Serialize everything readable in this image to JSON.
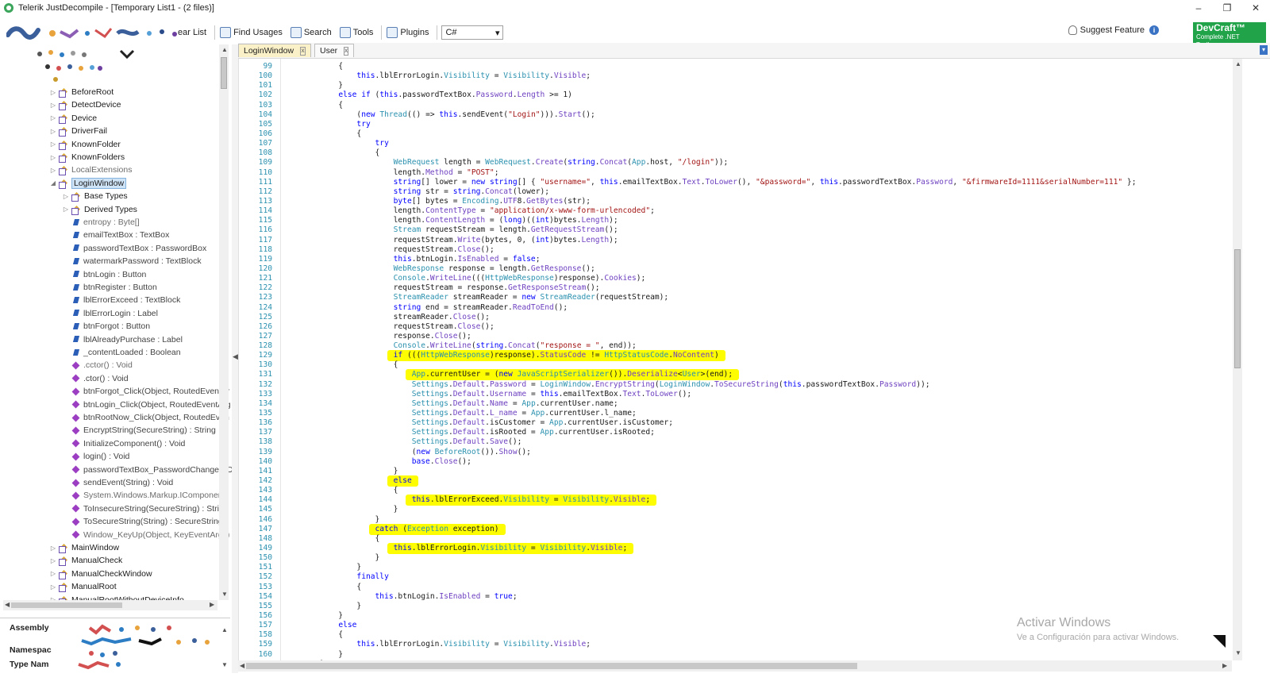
{
  "window": {
    "title": "Telerik JustDecompile - [Temporary List1 - (2 files)]",
    "minimize": "–",
    "restore": "❐",
    "close": "✕"
  },
  "toolbar": {
    "assembly_list_label": "ear List",
    "find_usages_label": "Find Usages",
    "search_label": "Search",
    "tools_label": "Tools",
    "plugins_label": "Plugins",
    "language_value": "C#",
    "suggest_feature_label": "Suggest Feature",
    "info_glyph": "i",
    "devcraft_title": "DevCraft™",
    "devcraft_subtitle": "Complete .NET Toolbox"
  },
  "tree": {
    "items": [
      {
        "label": "BeforeRoot",
        "kind": "class",
        "indent": 1
      },
      {
        "label": "DetectDevice",
        "kind": "class",
        "indent": 1
      },
      {
        "label": "Device",
        "kind": "class",
        "indent": 1
      },
      {
        "label": "DriverFail",
        "kind": "class",
        "indent": 1
      },
      {
        "label": "KnownFolder",
        "kind": "class",
        "indent": 1
      },
      {
        "label": "KnownFolders",
        "kind": "class",
        "indent": 1
      },
      {
        "label": "LocalExtensions",
        "kind": "class",
        "indent": 1,
        "dim": true
      },
      {
        "label": "LoginWindow",
        "kind": "class",
        "indent": 1,
        "selected": true,
        "expanded": true
      },
      {
        "label": "Base Types",
        "kind": "folder",
        "indent": 2
      },
      {
        "label": "Derived Types",
        "kind": "folder",
        "indent": 2
      },
      {
        "label": "entropy : Byte[]",
        "kind": "field",
        "indent": 2,
        "dim": true
      },
      {
        "label": "emailTextBox : TextBox",
        "kind": "field",
        "indent": 2
      },
      {
        "label": "passwordTextBox : PasswordBox",
        "kind": "field",
        "indent": 2
      },
      {
        "label": "watermarkPassword : TextBlock",
        "kind": "field",
        "indent": 2
      },
      {
        "label": "btnLogin : Button",
        "kind": "field",
        "indent": 2
      },
      {
        "label": "btnRegister : Button",
        "kind": "field",
        "indent": 2
      },
      {
        "label": "lblErrorExceed : TextBlock",
        "kind": "field",
        "indent": 2
      },
      {
        "label": "lblErrorLogin : Label",
        "kind": "field",
        "indent": 2
      },
      {
        "label": "btnForgot : Button",
        "kind": "field",
        "indent": 2
      },
      {
        "label": "lblAlreadyPurchase : Label",
        "kind": "field",
        "indent": 2
      },
      {
        "label": "_contentLoaded : Boolean",
        "kind": "field",
        "indent": 2
      },
      {
        "label": ".cctor() : Void",
        "kind": "method",
        "indent": 2,
        "dim": true
      },
      {
        "label": ".ctor() : Void",
        "kind": "method",
        "indent": 2
      },
      {
        "label": "btnForgot_Click(Object, RoutedEventAr",
        "kind": "method",
        "indent": 2
      },
      {
        "label": "btnLogin_Click(Object, RoutedEventArg",
        "kind": "method",
        "indent": 2
      },
      {
        "label": "btnRootNow_Click(Object, RoutedEven",
        "kind": "method",
        "indent": 2
      },
      {
        "label": "EncryptString(SecureString) : String",
        "kind": "method",
        "indent": 2
      },
      {
        "label": "InitializeComponent() : Void",
        "kind": "method",
        "indent": 2
      },
      {
        "label": "login() : Void",
        "kind": "method",
        "indent": 2
      },
      {
        "label": "passwordTextBox_PasswordChanged(O",
        "kind": "method",
        "indent": 2
      },
      {
        "label": "sendEvent(String) : Void",
        "kind": "method",
        "indent": 2
      },
      {
        "label": "System.Windows.Markup.IComponent",
        "kind": "method",
        "indent": 2,
        "dim": true
      },
      {
        "label": "ToInsecureString(SecureString) : String",
        "kind": "method",
        "indent": 2
      },
      {
        "label": "ToSecureString(String) : SecureString",
        "kind": "method",
        "indent": 2
      },
      {
        "label": "Window_KeyUp(Object, KeyEventArgs)",
        "kind": "method",
        "indent": 2,
        "dim": true
      },
      {
        "label": "MainWindow",
        "kind": "class",
        "indent": 1
      },
      {
        "label": "ManualCheck",
        "kind": "class",
        "indent": 1
      },
      {
        "label": "ManualCheckWindow",
        "kind": "class",
        "indent": 1
      },
      {
        "label": "ManualRoot",
        "kind": "class",
        "indent": 1
      },
      {
        "label": "ManualRootWithoutDeviceInfo",
        "kind": "class",
        "indent": 1
      }
    ]
  },
  "info_panel": {
    "assembly_label": "Assembly",
    "namespace_label": "Namespac",
    "type_name_label": "Type Nam"
  },
  "tabs": [
    {
      "label": "LoginWindow",
      "close": "x",
      "active": true
    },
    {
      "label": "User",
      "close": "x",
      "active": false
    }
  ],
  "code": {
    "first_line": 99,
    "lines": [
      "            {",
      "                this.lblErrorLogin.Visibility = Visibility.Visible;",
      "            }",
      "            else if (this.passwordTextBox.Password.Length >= 1)",
      "            {",
      "                (new Thread(() => this.sendEvent(\"Login\"))).Start();",
      "                try",
      "                {",
      "                    try",
      "                    {",
      "                        WebRequest length = WebRequest.Create(string.Concat(App.host, \"/login\"));",
      "                        length.Method = \"POST\";",
      "                        string[] lower = new string[] { \"username=\", this.emailTextBox.Text.ToLower(), \"&password=\", this.passwordTextBox.Password, \"&firmwareId=1111&serialNumber=111\" };",
      "                        string str = string.Concat(lower);",
      "                        byte[] bytes = Encoding.UTF8.GetBytes(str);",
      "                        length.ContentType = \"application/x-www-form-urlencoded\";",
      "                        length.ContentLength = (long)((int)bytes.Length);",
      "                        Stream requestStream = length.GetRequestStream();",
      "                        requestStream.Write(bytes, 0, (int)bytes.Length);",
      "                        requestStream.Close();",
      "                        this.btnLogin.IsEnabled = false;",
      "                        WebResponse response = length.GetResponse();",
      "                        Console.WriteLine(((HttpWebResponse)response).Cookies);",
      "                        requestStream = response.GetResponseStream();",
      "                        StreamReader streamReader = new StreamReader(requestStream);",
      "                        string end = streamReader.ReadToEnd();",
      "                        streamReader.Close();",
      "                        requestStream.Close();",
      "                        response.Close();",
      "                        Console.WriteLine(string.Concat(\"response = \", end));",
      "                        if (((HttpWebResponse)response).StatusCode != HttpStatusCode.NoContent)",
      "                        {",
      "                            App.currentUser = (new JavaScriptSerializer()).Deserialize<User>(end);",
      "                            Settings.Default.Password = LoginWindow.EncryptString(LoginWindow.ToSecureString(this.passwordTextBox.Password));",
      "                            Settings.Default.Username = this.emailTextBox.Text.ToLower();",
      "                            Settings.Default.Name = App.currentUser.name;",
      "                            Settings.Default.L_name = App.currentUser.l_name;",
      "                            Settings.Default.isCustomer = App.currentUser.isCustomer;",
      "                            Settings.Default.isRooted = App.currentUser.isRooted;",
      "                            Settings.Default.Save();",
      "                            (new BeforeRoot()).Show();",
      "                            base.Close();",
      "                        }",
      "                        else",
      "                        {",
      "                            this.lblErrorExceed.Visibility = Visibility.Visible;",
      "                        }",
      "                    }",
      "                    catch (Exception exception)",
      "                    {",
      "                        this.lblErrorLogin.Visibility = Visibility.Visible;",
      "                    }",
      "                }",
      "                finally",
      "                {",
      "                    this.btnLogin.IsEnabled = true;",
      "                }",
      "            }",
      "            else",
      "            {",
      "                this.lblErrorLogin.Visibility = Visibility.Visible;",
      "            }",
      "        }"
    ],
    "highlighted_lines": [
      129,
      131,
      142,
      144,
      147,
      149
    ]
  },
  "watermark": {
    "title": "Activar Windows",
    "subtitle": "Ve a Configuración para activar Windows."
  }
}
